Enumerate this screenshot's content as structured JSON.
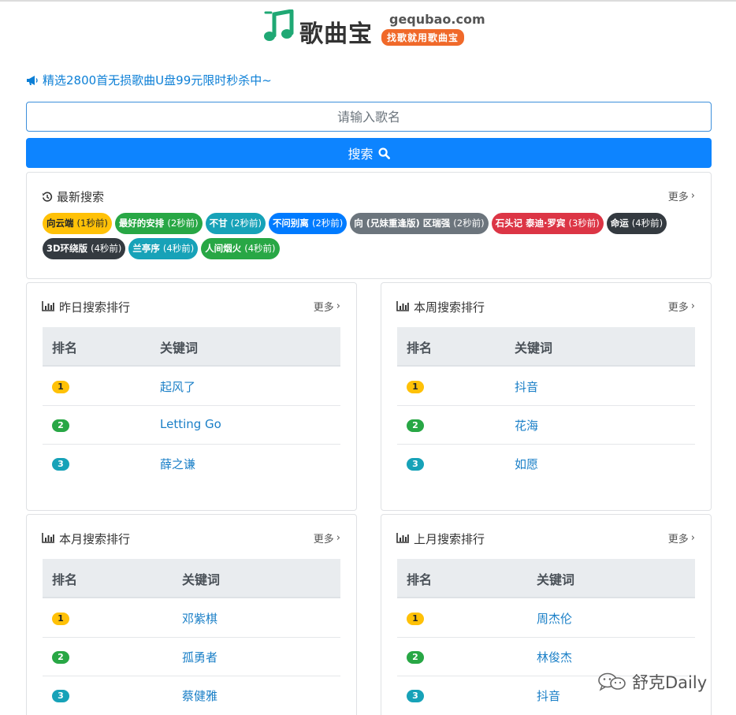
{
  "logo": {
    "name": "歌曲宝",
    "domain": "gequbao.com",
    "tagline": "找歌就用歌曲宝",
    "brand_color": "#1fa874",
    "tag_color": "#f0692a"
  },
  "promo": {
    "icon": "megaphone-icon",
    "text": "精选2800首无损歌曲U盘99元限时秒杀中~"
  },
  "search": {
    "placeholder": "请输入歌名",
    "value": "",
    "button_label": "搜索",
    "button_icon": "search-icon"
  },
  "recent": {
    "title": "最新搜索",
    "icon": "history-icon",
    "more_label": "更多",
    "tags": [
      {
        "name": "向云端",
        "ago": "(1秒前)",
        "color": "#ffc107",
        "text_color": "#212529"
      },
      {
        "name": "最好的安排",
        "ago": "(2秒前)",
        "color": "#28a745",
        "text_color": "#ffffff"
      },
      {
        "name": "不甘",
        "ago": "(2秒前)",
        "color": "#17a2b8",
        "text_color": "#ffffff"
      },
      {
        "name": "不问别离",
        "ago": "(2秒前)",
        "color": "#007bff",
        "text_color": "#ffffff"
      },
      {
        "name": "向 (兄妹重逢版) 区瑞强",
        "ago": "(2秒前)",
        "color": "#6c757d",
        "text_color": "#ffffff"
      },
      {
        "name": "石头记 泰迪·罗宾",
        "ago": "(3秒前)",
        "color": "#dc3545",
        "text_color": "#ffffff"
      },
      {
        "name": "命运",
        "ago": "(4秒前)",
        "color": "#343a40",
        "text_color": "#ffffff"
      },
      {
        "name": "3D环绕版",
        "ago": "(4秒前)",
        "color": "#343a40",
        "text_color": "#ffffff"
      },
      {
        "name": "兰亭序",
        "ago": "(4秒前)",
        "color": "#17a2b8",
        "text_color": "#ffffff"
      },
      {
        "name": "人间烟火",
        "ago": "(4秒前)",
        "color": "#28a745",
        "text_color": "#ffffff"
      }
    ]
  },
  "rank_header": {
    "rank": "排名",
    "keyword": "关键词"
  },
  "rank_badge_colors": [
    "#ffc107",
    "#28a745",
    "#17a2b8"
  ],
  "rankings": [
    {
      "title": "昨日搜索排行",
      "more_label": "更多",
      "rows": [
        {
          "rank": "1",
          "keyword": "起风了"
        },
        {
          "rank": "2",
          "keyword": "Letting Go"
        },
        {
          "rank": "3",
          "keyword": "薛之谦"
        }
      ]
    },
    {
      "title": "本周搜索排行",
      "more_label": "更多",
      "rows": [
        {
          "rank": "1",
          "keyword": "抖音"
        },
        {
          "rank": "2",
          "keyword": "花海"
        },
        {
          "rank": "3",
          "keyword": "如愿"
        }
      ]
    },
    {
      "title": "本月搜索排行",
      "more_label": "更多",
      "rows": [
        {
          "rank": "1",
          "keyword": "邓紫棋"
        },
        {
          "rank": "2",
          "keyword": "孤勇者"
        },
        {
          "rank": "3",
          "keyword": "蔡健雅"
        }
      ]
    },
    {
      "title": "上月搜索排行",
      "more_label": "更多",
      "rows": [
        {
          "rank": "1",
          "keyword": "周杰伦"
        },
        {
          "rank": "2",
          "keyword": "林俊杰"
        },
        {
          "rank": "3",
          "keyword": "抖音"
        }
      ]
    }
  ],
  "watermark": {
    "text": "舒克Daily",
    "icon": "wechat-icon"
  }
}
